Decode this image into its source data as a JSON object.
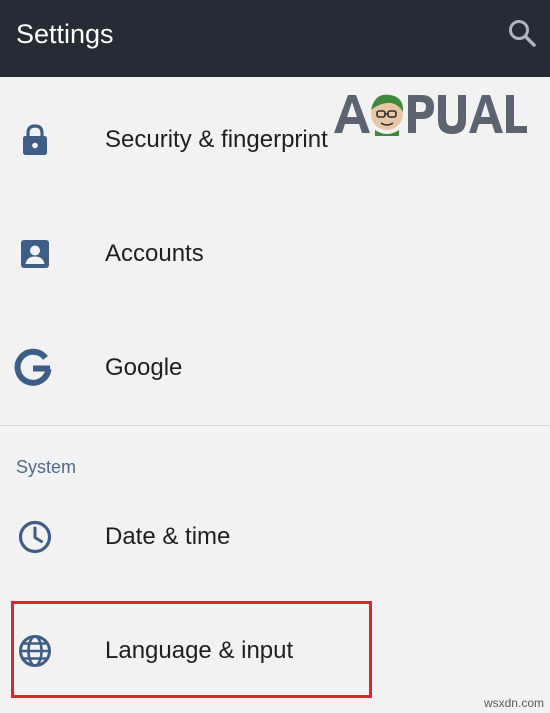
{
  "appbar": {
    "title": "Settings",
    "search_icon": "search-icon",
    "background": "#262b34"
  },
  "watermark": {
    "text": "APPUALS",
    "icon": "appuals-mascot-logo"
  },
  "items": [
    {
      "label": "Security & fingerprint",
      "icon": "lock-icon"
    },
    {
      "label": "Accounts",
      "icon": "account-box-icon"
    },
    {
      "label": "Google",
      "icon": "google-g-icon"
    }
  ],
  "system_section": {
    "header": "System",
    "items": [
      {
        "label": "Date & time",
        "icon": "clock-icon"
      },
      {
        "label": "Language & input",
        "icon": "globe-icon",
        "highlighted": true
      }
    ]
  },
  "colors": {
    "icon": "#3f5e86",
    "section_header": "#4f6b8c",
    "highlight": "#d52a2a"
  },
  "footer_watermark": "wsxdn.com"
}
